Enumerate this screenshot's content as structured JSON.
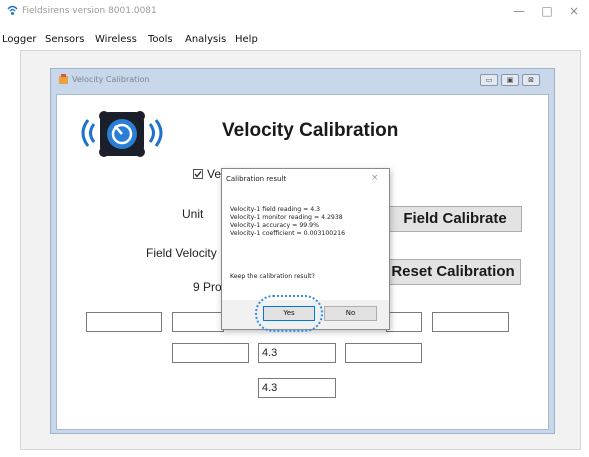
{
  "window": {
    "title": "Fieldsirens version 8001.0081",
    "minimize": "—",
    "maximize": "□",
    "close": "×"
  },
  "menu": [
    "Logger",
    "Sensors",
    "Wireless",
    "Tools",
    "Analysis",
    "Help"
  ],
  "child_window": {
    "title": "Velocity Calibration"
  },
  "form": {
    "heading": "Velocity Calibration",
    "checkbox_label": "Ve",
    "unit_label": "Unit",
    "field_velocity_label": "Field Velocity",
    "probe_label": "9 Pro",
    "field_calibrate_button": "Field Calibrate",
    "reset_calibration_button": "Reset Calibration",
    "fields": {
      "a": "",
      "b": "",
      "c": "",
      "d": "",
      "e": "",
      "f": "",
      "g": "4.3",
      "h": "",
      "i": "4.3"
    }
  },
  "dialog": {
    "title": "Calibration result",
    "close": "×",
    "lines": [
      "Velocity-1 field reading = 4.3",
      "Velocity-1 monitor reading = 4.2938",
      "Velocity-1 accuracy = 99.9%",
      "Velocity-1 coefficient = 0.003100216"
    ],
    "question": "Keep the calibration result?",
    "yes": "Yes",
    "no": "No"
  },
  "colors": {
    "accent": "#0078d7",
    "highlight_ring": "#2f8de4",
    "logo_blue": "#1e73c8",
    "child_frame": "#c8d7ea"
  }
}
